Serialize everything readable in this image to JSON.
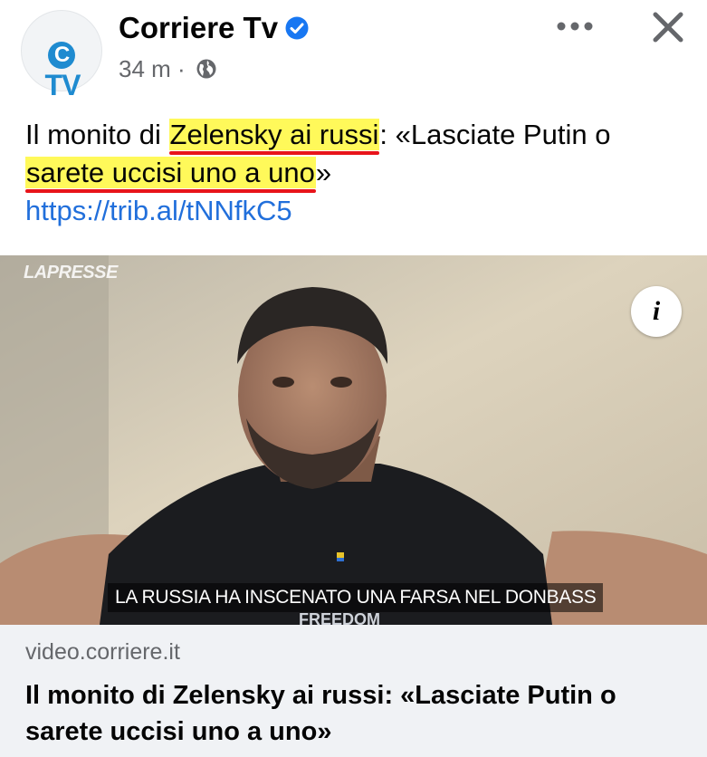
{
  "header": {
    "page_name": "Corriere Tv",
    "avatar_text": "TV",
    "avatar_letter": "C",
    "time": "34 m",
    "separator": "·"
  },
  "post": {
    "text_before": "Il monito di ",
    "highlight_1": "Zelensky ai russi",
    "text_middle": ": «Lasciate Putin o ",
    "highlight_2": "sarete uccisi uno a uno",
    "text_after": "»",
    "link": "https://trib.al/tNNfkC5"
  },
  "media": {
    "watermark": "LAPRESSE",
    "info_label": "i",
    "subtitle": "LA RUSSIA HA INSCENATO UNA FARSA NEL DONBASS",
    "shirt_text": "FREEDOM"
  },
  "preview": {
    "domain": "video.corriere.it",
    "title": "Il monito di Zelensky ai russi: «Lasciate Putin o sarete uccisi uno a uno»"
  },
  "colors": {
    "verified": "#1877f2",
    "link": "#216fdb",
    "highlight": "#fff95a",
    "underline": "#e8141a",
    "brand": "#1f8bd0"
  }
}
